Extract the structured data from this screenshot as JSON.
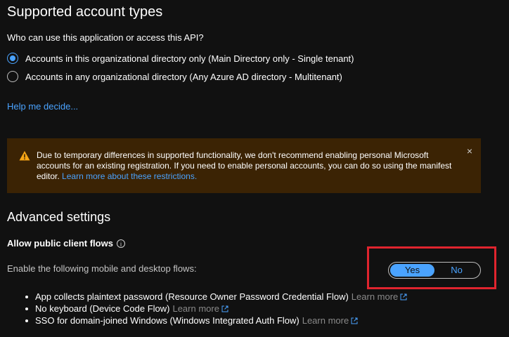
{
  "section": {
    "title": "Supported account types",
    "question": "Who can use this application or access this API?",
    "options": [
      {
        "label": "Accounts in this organizational directory only (Main Directory only - Single tenant)",
        "selected": true
      },
      {
        "label": "Accounts in any organizational directory (Any Azure AD directory - Multitenant)",
        "selected": false
      }
    ],
    "help_link": "Help me decide..."
  },
  "banner": {
    "text": "Due to temporary differences in supported functionality, we don't recommend enabling personal Microsoft accounts for an existing registration. If you need to enable personal accounts, you can do so using the manifest editor.",
    "link": "Learn more about these restrictions.",
    "close_glyph": "×",
    "icon": "warning-icon"
  },
  "advanced": {
    "title": "Advanced settings",
    "public_client_label": "Allow public client flows",
    "info_glyph": "i",
    "enable_desc": "Enable the following mobile and desktop flows:",
    "toggle": {
      "yes": "Yes",
      "no": "No",
      "selected": "Yes"
    },
    "flows": [
      {
        "text": "App collects plaintext password (Resource Owner Password Credential Flow)",
        "link": "Learn more"
      },
      {
        "text": "No keyboard (Device Code Flow)",
        "link": "Learn more"
      },
      {
        "text": "SSO for domain-joined Windows (Windows Integrated Auth Flow)",
        "link": "Learn more"
      }
    ]
  },
  "colors": {
    "accent": "#4aa3ff",
    "warning_bg": "#3b2304",
    "highlight": "#e0242e"
  }
}
